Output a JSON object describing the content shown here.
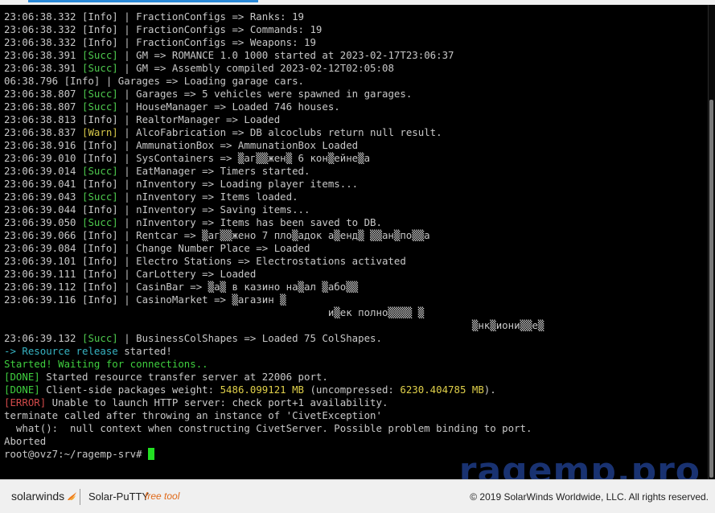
{
  "terminal": {
    "lines": [
      [
        {
          "t": "23:06:38.332 [Info] | FractionConfigs => Ranks: 19"
        }
      ],
      [
        {
          "t": "23:06:38.332 [Info] | FractionConfigs => Commands: 19"
        }
      ],
      [
        {
          "t": "23:06:38.332 [Info] | FractionConfigs => Weapons: 19"
        }
      ],
      [
        {
          "t": "23:06:38.391 "
        },
        {
          "t": "[Succ]",
          "c": "succ"
        },
        {
          "t": " | GM => ROMANCE 1.0 1000 started at 2023-02-17T23:06:37"
        }
      ],
      [
        {
          "t": "23:06:38.391 "
        },
        {
          "t": "[Succ]",
          "c": "succ"
        },
        {
          "t": " | GM => Assembly compiled 2023-02-12T02:05:08"
        }
      ],
      [
        {
          "t": "06:38.796 [Info] | Garages => Loading garage cars."
        }
      ],
      [
        {
          "t": "23:06:38.807 "
        },
        {
          "t": "[Succ]",
          "c": "succ"
        },
        {
          "t": " | Garages => 5 vehicles were spawned in garages."
        }
      ],
      [
        {
          "t": "23:06:38.807 "
        },
        {
          "t": "[Succ]",
          "c": "succ"
        },
        {
          "t": " | HouseManager => Loaded 746 houses."
        }
      ],
      [
        {
          "t": "23:06:38.813 [Info] | RealtorManager => Loaded"
        }
      ],
      [
        {
          "t": "23:06:38.837 "
        },
        {
          "t": "[Warn]",
          "c": "warn"
        },
        {
          "t": " | AlcoFabrication => DB alcoclubs return null result."
        }
      ],
      [
        {
          "t": "23:06:38.916 [Info] | AmmunationBox => AmmunationBox Loaded"
        }
      ],
      [
        {
          "t": "23:06:39.010 [Info] | SysContainers => ▒аг▒▒жен▒ 6 кон▒ейне▒а"
        }
      ],
      [
        {
          "t": "23:06:39.014 "
        },
        {
          "t": "[Succ]",
          "c": "succ"
        },
        {
          "t": " | EatManager => Timers started."
        }
      ],
      [
        {
          "t": "23:06:39.041 [Info] | nInventory => Loading player items..."
        }
      ],
      [
        {
          "t": "23:06:39.043 "
        },
        {
          "t": "[Succ]",
          "c": "succ"
        },
        {
          "t": " | nInventory => Items loaded."
        }
      ],
      [
        {
          "t": "23:06:39.044 [Info] | nInventory => Saving items..."
        }
      ],
      [
        {
          "t": "23:06:39.050 "
        },
        {
          "t": "[Succ]",
          "c": "succ"
        },
        {
          "t": " | nInventory => Items has been saved to DB."
        }
      ],
      [
        {
          "t": "23:06:39.066 [Info] | Rentcar => ▒аг▒▒жено 7 пло▒адок а▒енд▒ ▒▒ан▒по▒▒а"
        }
      ],
      [
        {
          "t": "23:06:39.084 [Info] | Change Number Place => Loaded"
        }
      ],
      [
        {
          "t": "23:06:39.101 [Info] | Electro Stations => Electrostations activated"
        }
      ],
      [
        {
          "t": "23:06:39.111 [Info] | CarLottery => Loaded"
        }
      ],
      [
        {
          "t": "23:06:39.112 [Info] | CasinBar => ▒а▒ в казино на▒ал ▒або▒▒"
        }
      ],
      [
        {
          "t": "23:06:39.116 [Info] | CasinoMarket => ▒агазин ▒"
        }
      ],
      [
        {
          "t": "                                                      и▒ек полно▒▒▒▒ ▒"
        }
      ],
      [
        {
          "t": "                                                                              ▒нк▒иони▒▒е▒"
        }
      ],
      [
        {
          "t": "23:06:39.132 "
        },
        {
          "t": "[Succ]",
          "c": "succ"
        },
        {
          "t": " | BusinessColShapes => Loaded 75 ColShapes."
        }
      ],
      [
        {
          "t": "-> Resource ",
          "c": "cyan"
        },
        {
          "t": "release",
          "c": "cyan"
        },
        {
          "t": " started!"
        }
      ],
      [
        {
          "t": "Started! Waiting for connections..",
          "c": "green"
        }
      ],
      [
        {
          "t": "[DONE]",
          "c": "green"
        },
        {
          "t": " Started resource transfer server at 22006 port."
        }
      ],
      [
        {
          "t": "[DONE]",
          "c": "green"
        },
        {
          "t": " Client-side packages weight: "
        },
        {
          "t": "5486.099121 MB",
          "c": "yellow"
        },
        {
          "t": " (uncompressed: "
        },
        {
          "t": "6230.404785 MB",
          "c": "yellow"
        },
        {
          "t": ")."
        }
      ],
      [
        {
          "t": "[ERROR]",
          "c": "err"
        },
        {
          "t": " Unable to launch HTTP server: check port+1 availability."
        }
      ],
      [
        {
          "t": "terminate called after throwing an instance of 'CivetException'"
        }
      ],
      [
        {
          "t": "  what():  null context when constructing CivetServer. Possible problem binding to port."
        }
      ],
      [
        {
          "t": "Aborted"
        }
      ],
      [
        {
          "t": "root@ovz7:~/ragemp-srv# "
        }
      ]
    ]
  },
  "watermark": "ragemp.pro",
  "footer": {
    "brand": "solarwinds",
    "product": "Solar-PuTTY",
    "product_tag": "free tool",
    "copyright": "© 2019 SolarWinds Worldwide, LLC. All rights reserved."
  },
  "colors": {
    "succ": "#4ec94e",
    "warn": "#d6c84a",
    "error": "#d24a4a",
    "accent": "#2a89d8",
    "brand_orange": "#e06a1a"
  },
  "icons": {
    "flame": "solarwinds-flame-icon",
    "cursor": "terminal-cursor"
  }
}
